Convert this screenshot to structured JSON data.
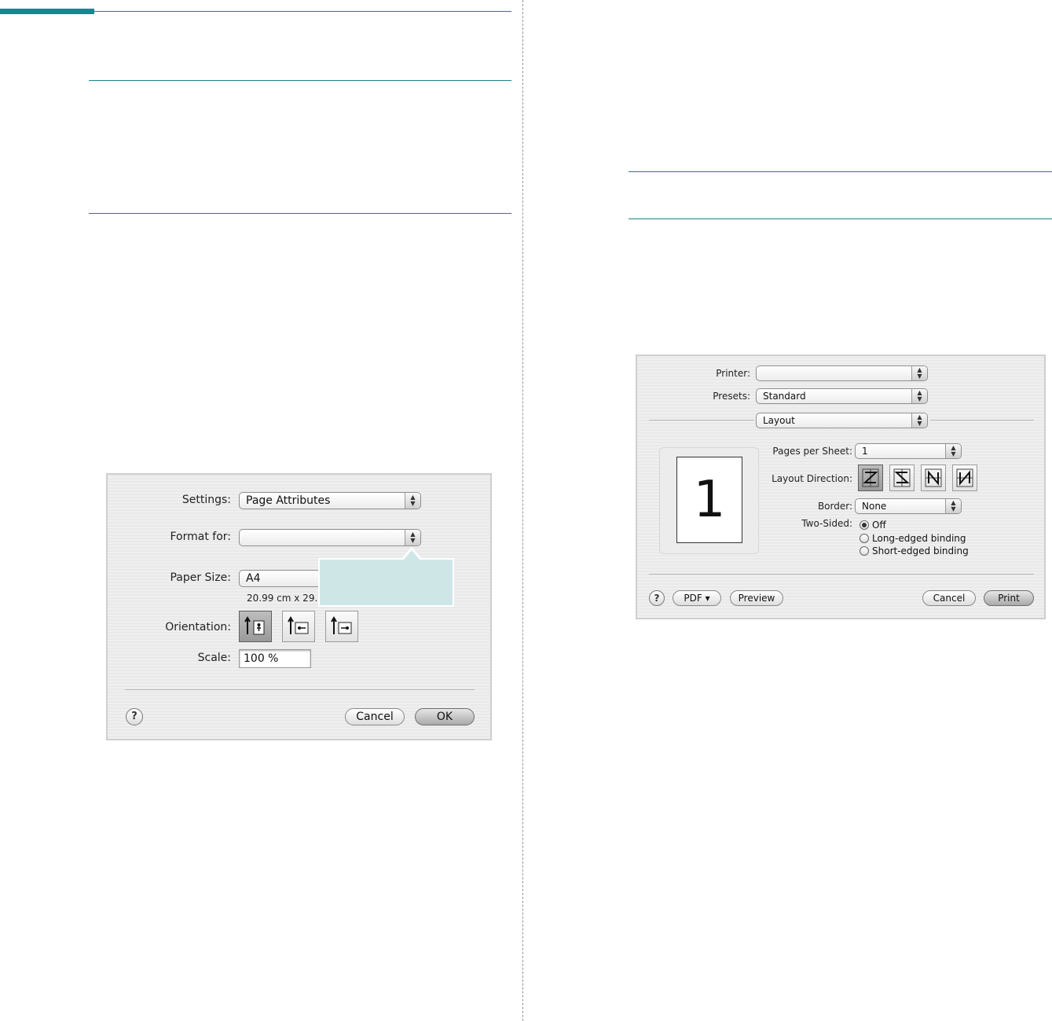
{
  "page_setup_dialog": {
    "settings_label": "Settings:",
    "settings_value": "Page Attributes",
    "format_for_label": "Format for:",
    "format_for_value": "",
    "paper_size_label": "Paper Size:",
    "paper_size_value": "A4",
    "paper_dimensions": "20.99 cm x 29.",
    "orientation_label": "Orientation:",
    "orientation_options": [
      "portrait-icon",
      "landscape-left-icon",
      "landscape-right-icon"
    ],
    "orientation_selected": 0,
    "scale_label": "Scale:",
    "scale_value": "100 %",
    "help_label": "?",
    "cancel_label": "Cancel",
    "ok_label": "OK"
  },
  "print_dialog": {
    "printer_label": "Printer:",
    "printer_value": "",
    "presets_label": "Presets:",
    "presets_value": "Standard",
    "panel_value": "Layout",
    "preview_page_number": "1",
    "pages_per_sheet_label": "Pages per Sheet:",
    "pages_per_sheet_value": "1",
    "layout_direction_label": "Layout Direction:",
    "layout_direction_options": [
      "z-direction-icon",
      "reverse-s-direction-icon",
      "n-reverse-direction-icon",
      "n-direction-icon"
    ],
    "layout_direction_selected": 0,
    "border_label": "Border:",
    "border_value": "None",
    "two_sided_label": "Two-Sided:",
    "two_sided_options": [
      "Off",
      "Long-edged binding",
      "Short-edged binding"
    ],
    "two_sided_selected": 0,
    "help_label": "?",
    "pdf_label": "PDF ▾",
    "preview_label": "Preview",
    "cancel_label": "Cancel",
    "print_label": "Print"
  },
  "colors": {
    "accent": "#0f8a8e",
    "rule": "#1f7f82",
    "callout": "#cfe6e7"
  }
}
